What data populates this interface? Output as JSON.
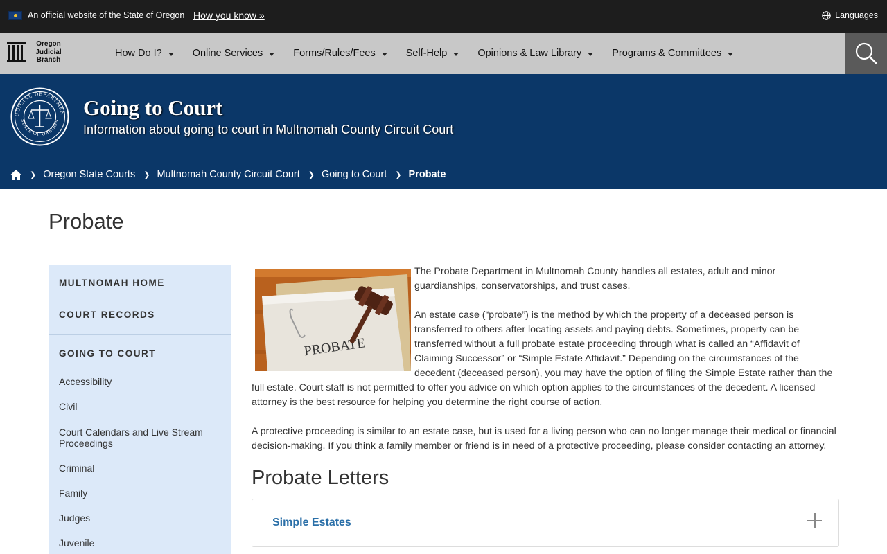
{
  "banner": {
    "official_text": "An official website of the State of Oregon",
    "how_you_know": "How you know »",
    "languages": "Languages"
  },
  "logo": {
    "line1": "Oregon",
    "line2": "Judicial",
    "line3": "Branch"
  },
  "nav": {
    "items": [
      {
        "label": "How Do I?"
      },
      {
        "label": "Online Services"
      },
      {
        "label": "Forms/Rules/Fees"
      },
      {
        "label": "Self-Help"
      },
      {
        "label": "Opinions & Law Library"
      },
      {
        "label": "Programs & Committees"
      }
    ],
    "search_icon": "search-icon"
  },
  "hero": {
    "title": "Going to Court",
    "subtitle": "Information about going to court in Multnomah County Circuit Court",
    "seal_icon": "judicial-department-seal",
    "colors": {
      "background": "#0b3768"
    }
  },
  "breadcrumb": {
    "items": [
      {
        "label": "Oregon State Courts"
      },
      {
        "label": "Multnomah County Circuit Court"
      },
      {
        "label": "Going to Court"
      }
    ],
    "current": "Probate"
  },
  "page": {
    "title": "Probate"
  },
  "sidebar": {
    "headings": [
      "MULTNOMAH HOME",
      "COURT RECORDS",
      "GOING TO COURT"
    ],
    "links": [
      {
        "label": "Accessibility"
      },
      {
        "label": "Civil"
      },
      {
        "label": "Court Calendars and Live Stream Proceedings"
      },
      {
        "label": "Criminal"
      },
      {
        "label": "Family"
      },
      {
        "label": "Judges"
      },
      {
        "label": "Juvenile"
      }
    ]
  },
  "content": {
    "image_caption": "PROBATE",
    "p1": "The Probate Department in Multnomah County handles all estates, adult and minor guardianships, conservatorships, and trust cases.",
    "p2": "An estate case (“probate”) is the method by which the property of a deceased person is transferred to others after locating assets and paying debts. Sometimes, property can be transferred without a full probate estate proceeding through what is called an “Affidavit of Claiming Successor” or “Simple Estate Affidavit.” Depending on the circumstances of the decedent (deceased person), you may have the option of filing the Simple Estate rather than the full estate. Court staff is not permitted to offer you advice on which option applies to the circumstances of the decedent. A licensed attorney is the best resource for helping you determine the right course of action.",
    "p3": "A protective proceeding is similar to an estate case, but is used for a living person who can no longer manage their medical or financial decision-making. If you think a family member or friend is in need of a protective proceeding, please consider contacting an attorney.",
    "section_title": "Probate Letters",
    "accordion": [
      {
        "label": "Simple Estates",
        "expanded": false
      }
    ]
  }
}
